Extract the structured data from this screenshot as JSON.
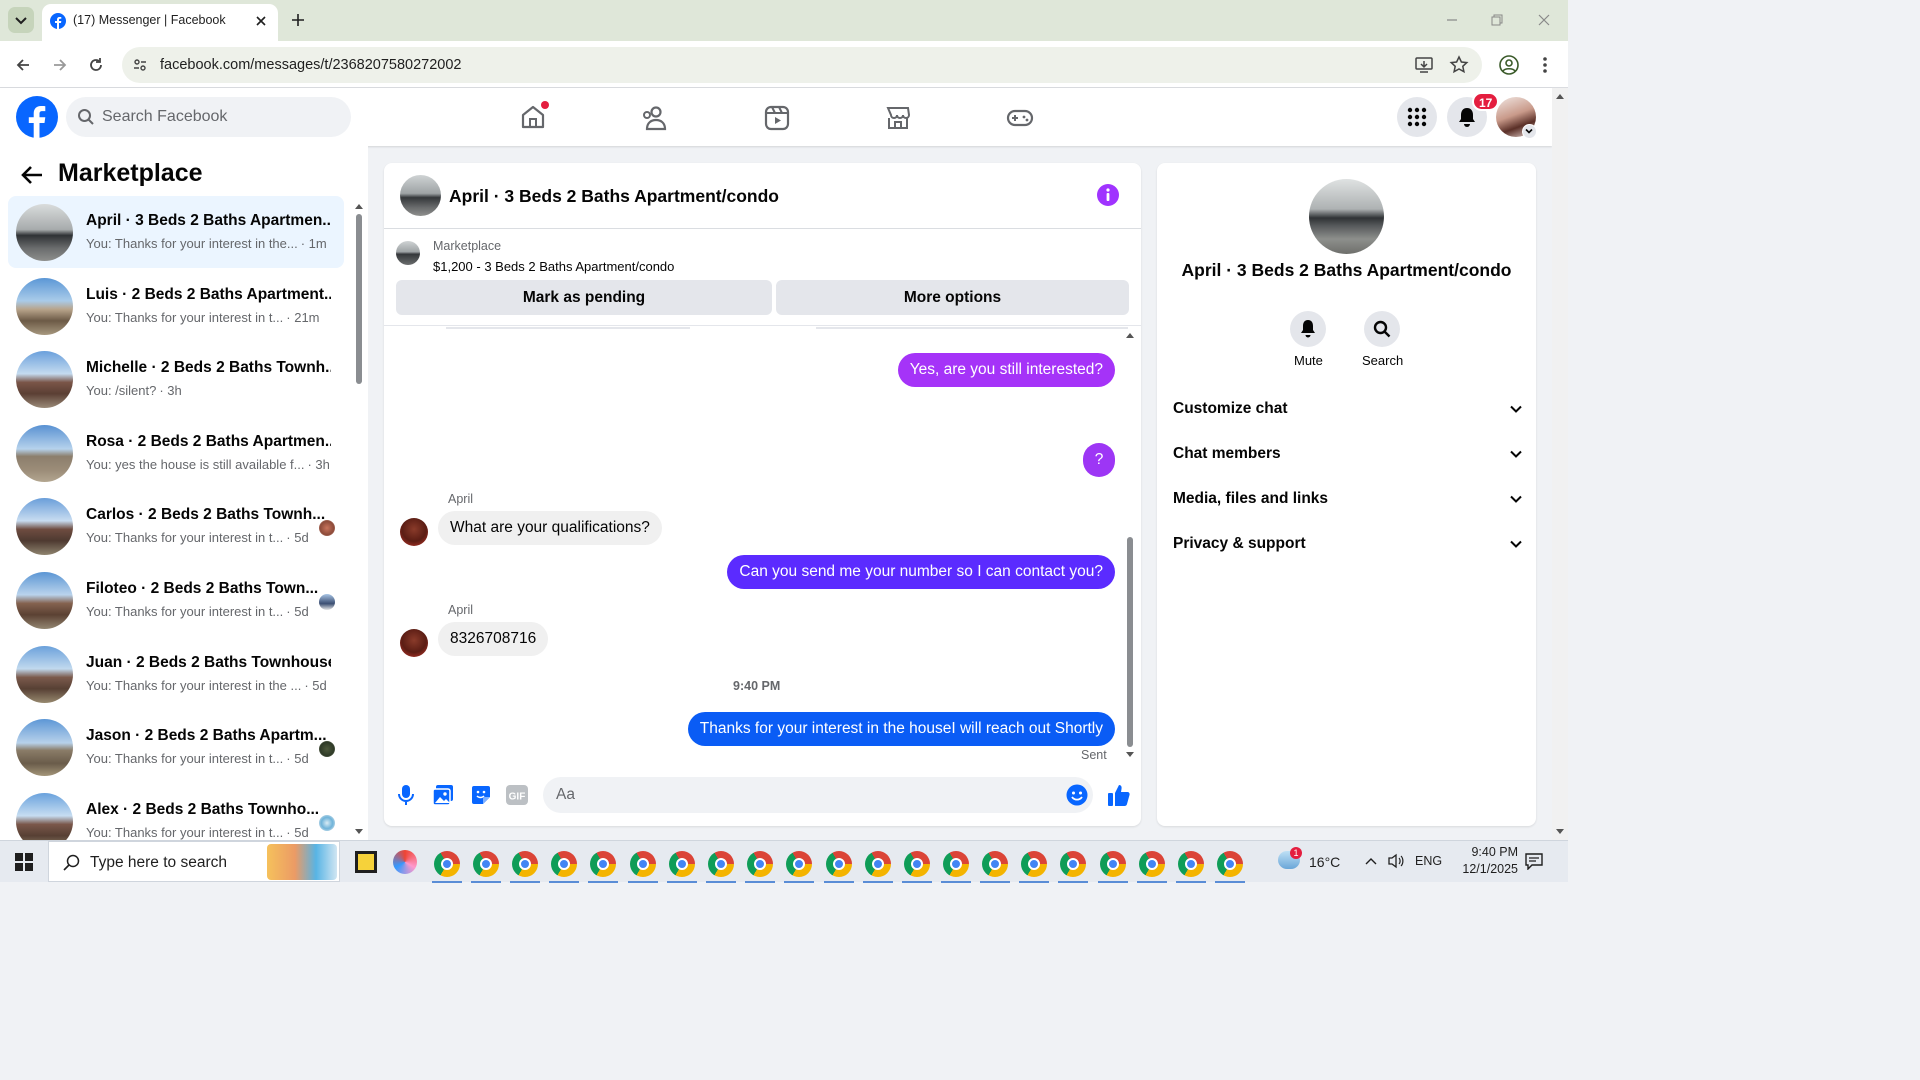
{
  "browser": {
    "tab_title": "(17) Messenger | Facebook",
    "url": "facebook.com/messages/t/2368207580272002"
  },
  "fb_header": {
    "search_placeholder": "Search Facebook",
    "notifications_count": "17"
  },
  "left_pane": {
    "title": "Marketplace",
    "conversations": [
      {
        "title": "April · 3 Beds 2 Baths Apartmen...",
        "preview": "You: Thanks for your interest in the...",
        "time": "· 1m",
        "selected": true
      },
      {
        "title": "Luis · 2 Beds 2 Baths Apartment...",
        "preview": "You: Thanks for your interest in t...",
        "time": "· 21m"
      },
      {
        "title": "Michelle · 2 Beds 2 Baths Townh...",
        "preview": "You: /silent?",
        "time": "· 3h"
      },
      {
        "title": "Rosa · 2 Beds 2 Baths Apartmen...",
        "preview": "You: yes the house is still available f...",
        "time": "· 3h"
      },
      {
        "title": "Carlos · 2 Beds 2 Baths Townh...",
        "preview": "You: Thanks for your interest in t...",
        "time": "· 5d"
      },
      {
        "title": "Filoteo · 2 Beds 2 Baths Town...",
        "preview": "You: Thanks for your interest in t...",
        "time": "· 5d"
      },
      {
        "title": "Juan · 2 Beds 2 Baths Townhouse",
        "preview": "You: Thanks for your interest in the ...",
        "time": "· 5d"
      },
      {
        "title": "Jason · 2 Beds 2 Baths Apartm...",
        "preview": "You: Thanks for your interest in t...",
        "time": "· 5d"
      },
      {
        "title": "Alex · 2 Beds 2 Baths Townho...",
        "preview": "You: Thanks for your interest in t...",
        "time": "· 5d"
      }
    ]
  },
  "chat": {
    "header_title": "April · 3 Beds 2 Baths Apartment/condo",
    "listing_label": "Marketplace",
    "listing_detail": "$1,200 - 3 Beds 2 Baths Apartment/condo",
    "mark_pending": "Mark as pending",
    "more_options": "More options",
    "messages": {
      "m1": "Yes, are you still interested?",
      "m2": "?",
      "sender1": "April",
      "m3": "What are your qualifications?",
      "m4": "Can you send me your number so I can contact you?",
      "sender2": "April",
      "m5": "8326708716",
      "timestamp": "9:40 PM",
      "m6": "Thanks for your interest in the houseI will reach out Shortly",
      "status": "Sent"
    },
    "composer_placeholder": "Aa"
  },
  "right_pane": {
    "title": "April · 3 Beds 2 Baths Apartment/condo",
    "mute_label": "Mute",
    "search_label": "Search",
    "sections": [
      "Customize chat",
      "Chat members",
      "Media, files and links",
      "Privacy & support"
    ]
  },
  "taskbar": {
    "search_placeholder": "Type here to search",
    "temperature": "16°C",
    "language": "ENG",
    "time": "9:40 PM",
    "date": "12/1/2025",
    "weather_badge": "1"
  },
  "colors": {
    "fb_blue": "#0866ff",
    "messenger_purple": "#a033ff",
    "bubble_mid": "#5b2bff",
    "bubble_blue": "#0a5cf5",
    "tab_strip": "#dfe7d9"
  }
}
